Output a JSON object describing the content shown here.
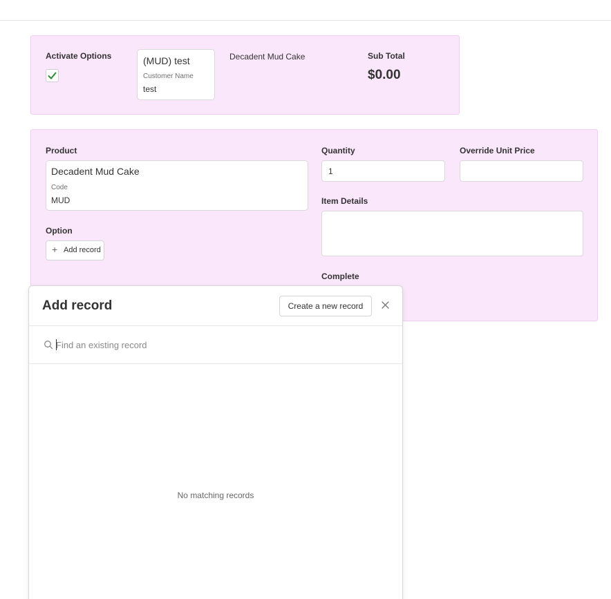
{
  "order_card": {
    "activate_options_label": "Activate Options",
    "activate_options_checked": true,
    "customer_ref": {
      "title": "(MUD) test",
      "sub_label": "Customer Name",
      "sub_value": "test"
    },
    "product_name": "Decadent Mud Cake",
    "subtotal_label": "Sub Total",
    "subtotal_value": "$0.00"
  },
  "line_item": {
    "product_label": "Product",
    "product_ref": {
      "title": "Decadent Mud Cake",
      "sub_label": "Code",
      "sub_value": "MUD"
    },
    "quantity_label": "Quantity",
    "quantity_value": "1",
    "override_unit_price_label": "Override Unit Price",
    "override_unit_price_value": "",
    "item_details_label": "Item Details",
    "item_details_value": "",
    "option_label": "Option",
    "add_record_label": "Add record",
    "complete_label": "Complete"
  },
  "add_record_panel": {
    "title": "Add record",
    "create_button_label": "Create a new record",
    "search_placeholder": "Find an existing record",
    "search_value": "",
    "empty_message": "No matching records"
  },
  "colors": {
    "card_background": "#fbe7fb",
    "card_border": "#f1cdf1",
    "checkmark": "#2e8b3a"
  },
  "icons": {
    "checkbox": "check-icon",
    "add": "plus-icon",
    "close": "close-icon",
    "search": "search-icon"
  }
}
